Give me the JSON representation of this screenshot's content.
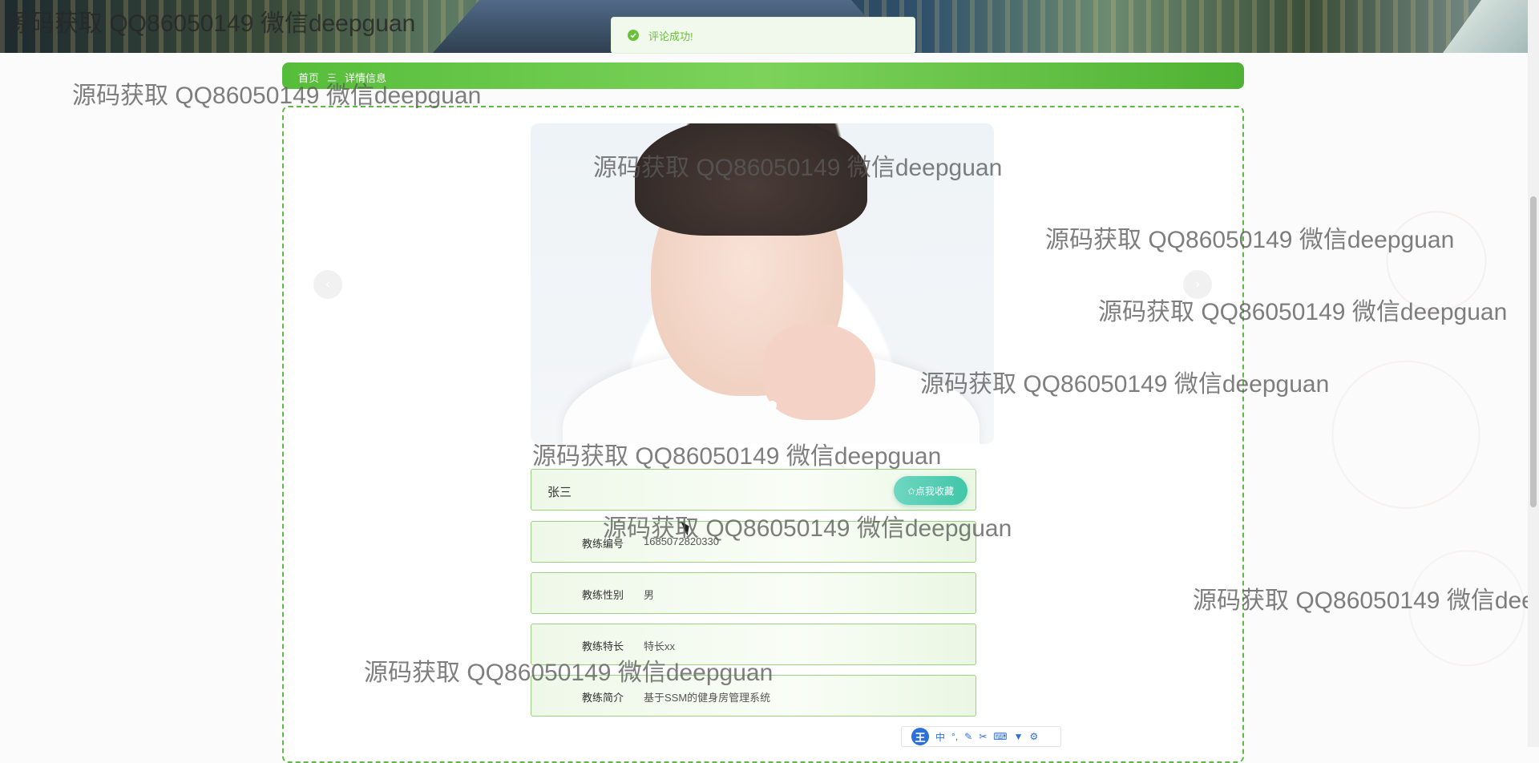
{
  "toast": {
    "message": "评论成功!"
  },
  "breadcrumb": {
    "home": "首页",
    "separator": "三",
    "current": "详情信息"
  },
  "carousel": {
    "dots": 1
  },
  "detail": {
    "name": "张三",
    "favorite_label": "✩点我收藏",
    "fields": [
      {
        "label": "教练编号",
        "value": "1685072820330"
      },
      {
        "label": "教练性别",
        "value": "男"
      },
      {
        "label": "教练特长",
        "value": "特长xx"
      },
      {
        "label": "教练简介",
        "value": "基于SSM的健身房管理系统"
      }
    ]
  },
  "watermark": "源码获取 QQ86050149 微信deepguan",
  "ime": {
    "logo": "王",
    "mode": "中"
  },
  "colors": {
    "accent": "#5dbb45",
    "success": "#67c23a",
    "favorite": "#41c6a8"
  }
}
